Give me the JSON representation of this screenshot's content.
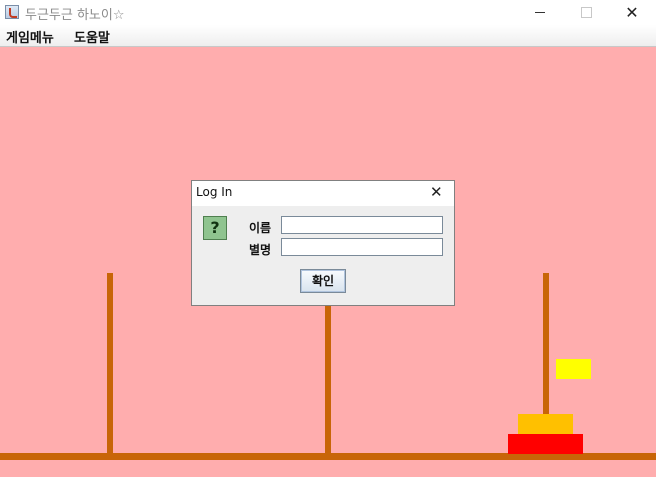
{
  "window": {
    "title": "두근두근 하노이☆",
    "minimize_symbol": "",
    "close_symbol": "✕"
  },
  "menu": {
    "items": [
      {
        "label": "게임메뉴"
      },
      {
        "label": "도움말"
      }
    ]
  },
  "game": {
    "background_color": "#ffadae",
    "pole_color": "#c86508",
    "disks": [
      {
        "color": "#ff0000"
      },
      {
        "color": "#ffc000"
      },
      {
        "color": "#ffff00"
      }
    ]
  },
  "dialog": {
    "title": "Log In",
    "close_symbol": "✕",
    "icon_glyph": "?",
    "name_label": "이름",
    "name_value": "",
    "nickname_label": "별명",
    "nickname_value": "",
    "confirm_label": "확인"
  }
}
